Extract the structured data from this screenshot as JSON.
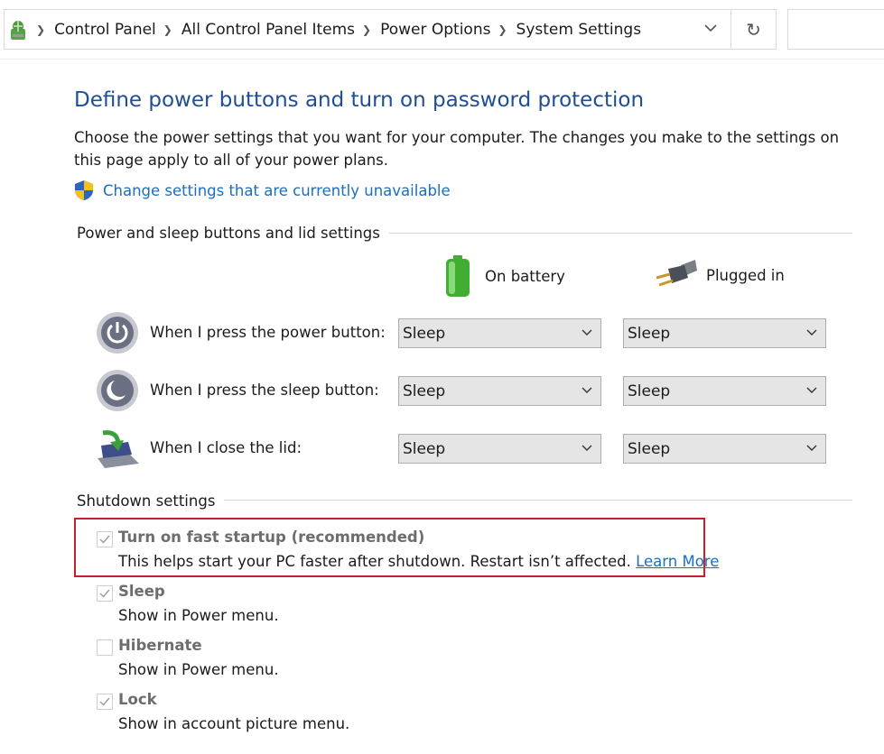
{
  "breadcrumb": {
    "items": [
      "Control Panel",
      "All Control Panel Items",
      "Power Options",
      "System Settings"
    ]
  },
  "icons": {
    "root": "control-panel-icon",
    "dropdown": "chevron-down-icon",
    "refresh": "refresh-icon",
    "shield": "uac-shield-icon",
    "battery": "battery-icon",
    "plug": "plug-icon",
    "power": "power-button-icon",
    "sleep": "sleep-button-icon",
    "lid": "laptop-lid-icon"
  },
  "refresh_glyph": "↻",
  "page": {
    "title": "Define power buttons and turn on password protection",
    "description": "Choose the power settings that you want for your computer. The changes you make to the settings on this page apply to all of your power plans.",
    "change_link": "Change settings that are currently unavailable"
  },
  "power_group": {
    "label": "Power and sleep buttons and lid settings",
    "col_battery": "On battery",
    "col_plugged": "Plugged in",
    "rows": [
      {
        "label": "When I press the power button:",
        "battery": "Sleep",
        "plugged": "Sleep"
      },
      {
        "label": "When I press the sleep button:",
        "battery": "Sleep",
        "plugged": "Sleep"
      },
      {
        "label": "When I close the lid:",
        "battery": "Sleep",
        "plugged": "Sleep"
      }
    ]
  },
  "shutdown_group": {
    "label": "Shutdown settings",
    "options": [
      {
        "title": "Turn on fast startup (recommended)",
        "desc": "This helps start your PC faster after shutdown. Restart isn’t affected.",
        "link": "Learn More",
        "checked": true
      },
      {
        "title": "Sleep",
        "desc": "Show in Power menu.",
        "checked": true
      },
      {
        "title": "Hibernate",
        "desc": "Show in Power menu.",
        "checked": false
      },
      {
        "title": "Lock",
        "desc": "Show in account picture menu.",
        "checked": true
      }
    ]
  },
  "colors": {
    "title": "#1e4e93",
    "link": "#1a6fbf",
    "highlight_border": "#c8202b"
  }
}
